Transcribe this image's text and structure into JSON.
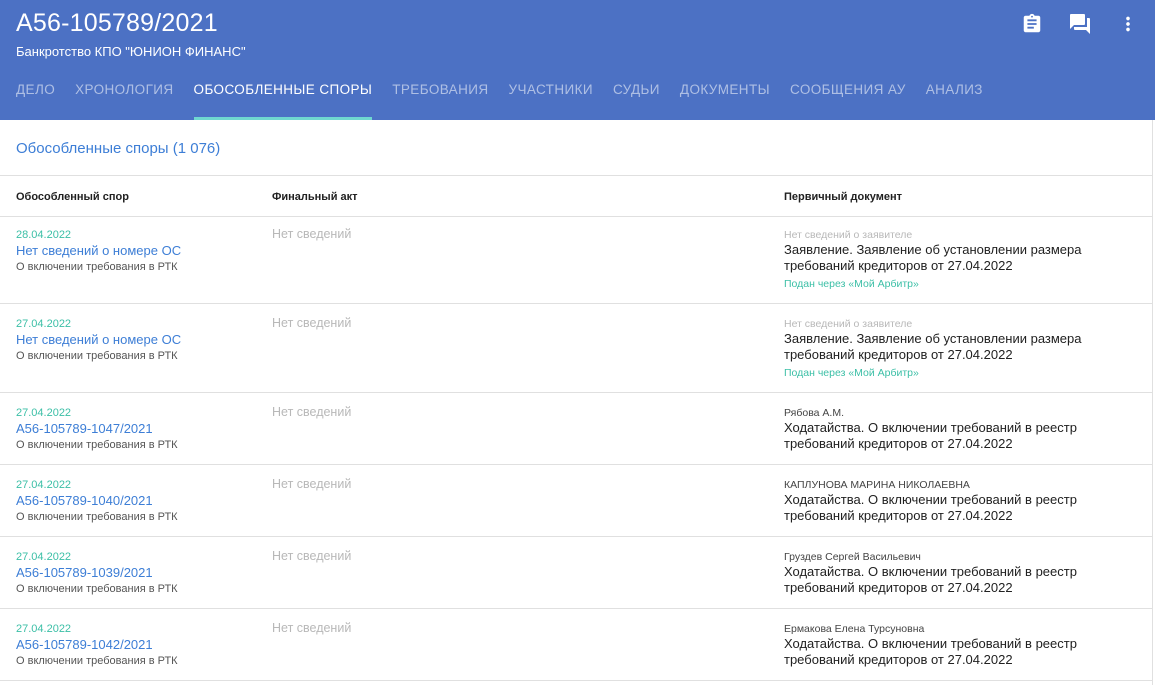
{
  "header": {
    "case_number": "А56-105789/2021",
    "case_title": "Банкротство КПО \"ЮНИОН ФИНАНС\"",
    "icons": [
      "clipboard-icon",
      "chat-icon",
      "more-vert-icon"
    ],
    "tabs": [
      {
        "label": "ДЕЛО"
      },
      {
        "label": "ХРОНОЛОГИЯ"
      },
      {
        "label": "ОБОСОБЛЕННЫЕ СПОРЫ"
      },
      {
        "label": "ТРЕБОВАНИЯ"
      },
      {
        "label": "УЧАСТНИКИ"
      },
      {
        "label": "СУДЬИ"
      },
      {
        "label": "ДОКУМЕНТЫ"
      },
      {
        "label": "СООБЩЕНИЯ АУ"
      },
      {
        "label": "АНАЛИЗ"
      }
    ],
    "active_tab": "ОБОСОБЛЕННЫЕ СПОРЫ"
  },
  "colors": {
    "header_bg": "#4c71c4",
    "tab_indicator": "#6fd8d0",
    "link": "#3d7ed6",
    "date_green": "#3bbfa6"
  },
  "section": {
    "title": "Обособленные споры (1 076)"
  },
  "table": {
    "columns": [
      "Обособленный спор",
      "Финальный акт",
      "Первичный документ"
    ],
    "rows": [
      {
        "date": "28.04.2022",
        "case": "Нет сведений о номере ОС",
        "subject": "О включении требования в РТК",
        "final_act": "Нет сведений",
        "applicant": "Нет сведений о заявителе",
        "document": "Заявление. Заявление об установлении размера требований кредиторов от 27.04.2022",
        "via": "Подан через «Мой Арбитр»"
      },
      {
        "date": "27.04.2022",
        "case": "Нет сведений о номере ОС",
        "subject": "О включении требования в РТК",
        "final_act": "Нет сведений",
        "applicant": "Нет сведений о заявителе",
        "document": "Заявление. Заявление об установлении размера требований кредиторов от 27.04.2022",
        "via": "Подан через «Мой Арбитр»"
      },
      {
        "date": "27.04.2022",
        "case": "А56-105789-1047/2021",
        "subject": "О включении требования в РТК",
        "final_act": "Нет сведений",
        "applicant": "Рябова А.М.",
        "document": "Ходатайства. О включении требований в реестр требований кредиторов от 27.04.2022",
        "via": ""
      },
      {
        "date": "27.04.2022",
        "case": "А56-105789-1040/2021",
        "subject": "О включении требования в РТК",
        "final_act": "Нет сведений",
        "applicant": "КАПЛУНОВА МАРИНА НИКОЛАЕВНА",
        "document": "Ходатайства. О включении требований в реестр требований кредиторов от 27.04.2022",
        "via": ""
      },
      {
        "date": "27.04.2022",
        "case": "А56-105789-1039/2021",
        "subject": "О включении требования в РТК",
        "final_act": "Нет сведений",
        "applicant": "Груздев Сергей Васильевич",
        "document": "Ходатайства. О включении требований в реестр требований кредиторов от 27.04.2022",
        "via": ""
      },
      {
        "date": "27.04.2022",
        "case": "А56-105789-1042/2021",
        "subject": "О включении требования в РТК",
        "final_act": "Нет сведений",
        "applicant": "Ермакова Елена Турсуновна",
        "document": "Ходатайства. О включении требований в реестр требований кредиторов от 27.04.2022",
        "via": ""
      }
    ]
  }
}
